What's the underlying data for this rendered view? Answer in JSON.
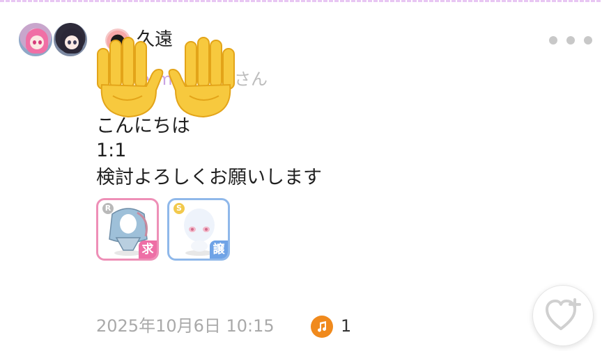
{
  "post": {
    "author": {
      "name": "久遠"
    },
    "mention": {
      "name": "ermi",
      "suffix": "さん"
    },
    "message_lines": [
      "こんにちは",
      "1:1",
      "検討よろしくお願いします"
    ],
    "items": [
      {
        "rarity": "R",
        "tag": "求"
      },
      {
        "rarity": "S",
        "tag": "譲"
      }
    ],
    "timestamp": "2025年10月6日 10:15",
    "note_count": "1"
  },
  "colors": {
    "want_border": "#ee8fb7",
    "give_border": "#8fb8ea",
    "note_icon_bg": "#f08a1d",
    "mention_text": "#c9a2e3"
  },
  "icons": {
    "more": "more-dots-icon",
    "note": "music-note-icon",
    "like": "heart-plus-icon",
    "hands": "raised-hand-emoji"
  }
}
